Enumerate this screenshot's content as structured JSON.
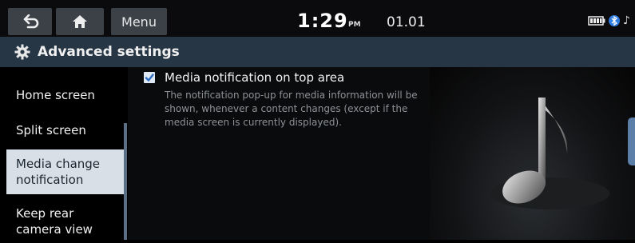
{
  "header": {
    "menu_label": "Menu",
    "time": "1:29",
    "ampm": "PM",
    "date": "01.01"
  },
  "titlebar": {
    "title": "Advanced settings"
  },
  "sidebar": {
    "items": [
      {
        "label": "Home screen"
      },
      {
        "label": "Split screen"
      },
      {
        "label": "Media change notification"
      },
      {
        "label": "Keep rear camera view"
      }
    ]
  },
  "content": {
    "option_label": "Media notification on top area",
    "option_checked": true,
    "option_description": "The notification pop-up for media information will be shown, whenever a content changes (except if the media screen is currently displayed)."
  },
  "icons": {
    "back": "back-arrow-icon",
    "home": "home-icon",
    "battery": "battery-icon",
    "bluetooth": "bluetooth-icon",
    "music": "music-note-icon",
    "gear": "gear-icon"
  },
  "colors": {
    "titlebar": "#263645",
    "active_item": "#d8dfe7",
    "scrollbar": "#5b6f86",
    "checkbox": "#dfe8f5"
  }
}
